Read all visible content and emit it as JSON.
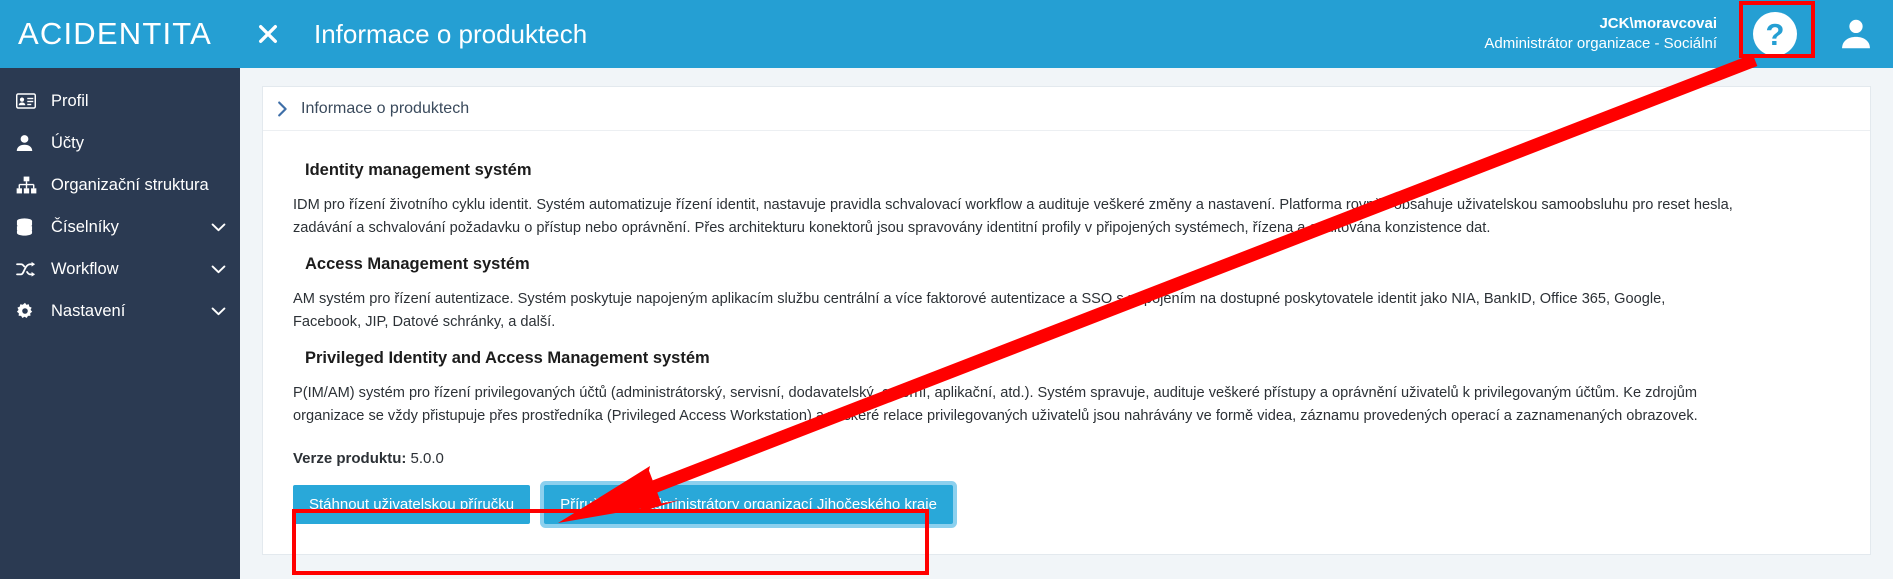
{
  "topbar": {
    "brand": "ACIDENTITA",
    "close_icon": "close-x-icon",
    "page_title": "Informace o produktech",
    "user_name": "JCK\\moravcovai",
    "user_role": "Administrátor organizace - Sociální",
    "help_glyph": "?",
    "help_icon": "help-question-icon",
    "avatar_icon": "user-avatar-icon",
    "bar_color": "#259fd3"
  },
  "sidebar": {
    "bg_color": "#2b3a52",
    "items": [
      {
        "label": "Profil",
        "icon": "id-card-icon",
        "chevron": false
      },
      {
        "label": "Účty",
        "icon": "user-icon",
        "chevron": false
      },
      {
        "label": "Organizační struktura",
        "icon": "sitemap-icon",
        "chevron": false
      },
      {
        "label": "Číselníky",
        "icon": "database-icon",
        "chevron": true
      },
      {
        "label": "Workflow",
        "icon": "shuffle-icon",
        "chevron": true
      },
      {
        "label": "Nastavení",
        "icon": "gear-icon",
        "chevron": true
      }
    ]
  },
  "breadcrumb": {
    "chevron_icon": "chevron-right-icon",
    "label": "Informace o produktech"
  },
  "main": {
    "sections": [
      {
        "heading": "Identity management systém",
        "text": "IDM pro řízení životního cyklu identit. Systém automatizuje řízení identit, nastavuje pravidla schvalovací workflow a audituje veškeré změny a nastavení. Platforma rovněž obsahuje uživatelskou samoobsluhu pro reset hesla, zadávání a schvalování požadavku o přístup nebo oprávnění. Přes architekturu konektorů jsou spravovány identitní profily v připojených systémech, řízena a auditována konzistence dat."
      },
      {
        "heading": "Access Management systém",
        "text": "AM systém pro řízení autentizace. Systém poskytuje napojeným aplikacím službu centrální a více faktorové autentizace a SSO s napojením na dostupné poskytovatele identit jako NIA, BankID, Office 365, Google, Facebook, JIP, Datové schránky, a další."
      },
      {
        "heading": "Privileged Identity and Access Management systém",
        "text": "P(IM/AM) systém pro řízení privilegovaných účtů (administrátorský, servisní, dodavatelský, externí, aplikační, atd.). Systém spravuje, audituje veškeré přístupy a oprávnění uživatelů k privilegovaným účtům. Ke zdrojům organizace se vždy přistupuje přes prostředníka (Privileged Access Workstation) a veškeré relace privilegovaných uživatelů jsou nahrávány ve formě videa, záznamu provedených operací a zaznamenaných obrazovek."
      }
    ],
    "version_label": "Verze produktu:",
    "version_value": "5.0.0",
    "buttons": [
      {
        "label": "Stáhnout uživatelskou příručku",
        "focused": false
      },
      {
        "label": "Příručky pro administrátory organizací Jihočeského kraje",
        "focused": true
      }
    ],
    "button_color": "#29a8d9"
  },
  "annotations": {
    "highlight_color": "#ff0000",
    "boxes": [
      "help-icon-highlight",
      "buttons-highlight"
    ],
    "arrow": "red-arrow-from-help-icon-to-buttons"
  }
}
